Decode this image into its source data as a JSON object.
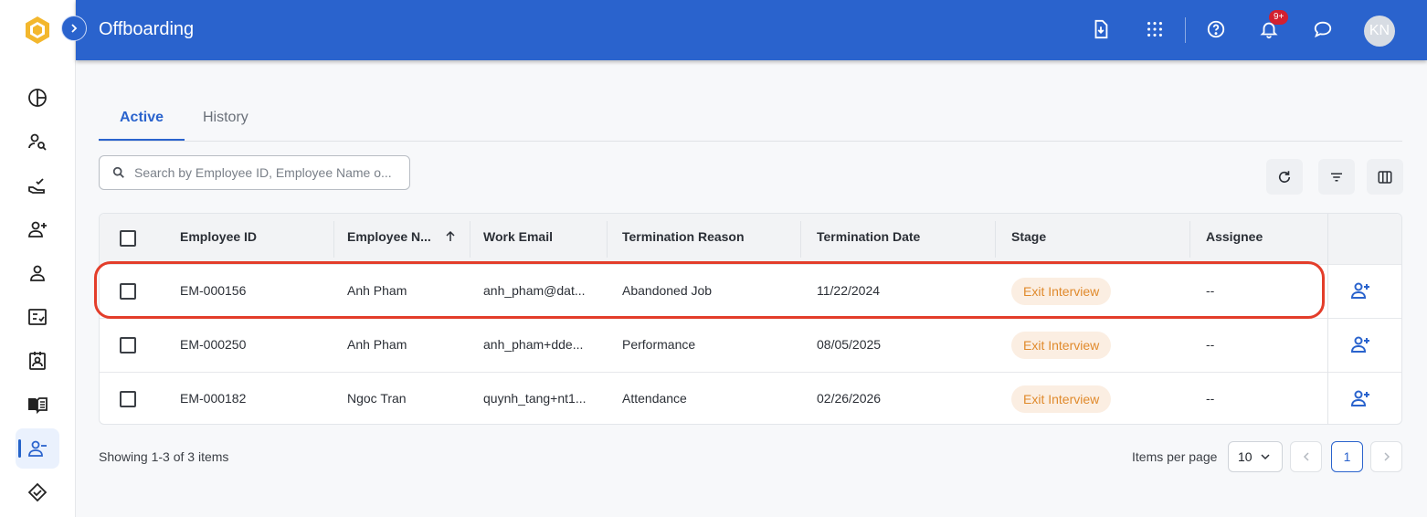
{
  "app": {
    "page_title": "Offboarding",
    "avatar_initials": "KN",
    "notification_badge": "9+"
  },
  "colors": {
    "header": "#2a63cd",
    "accent": "#2a63cd",
    "stage_text": "#e08a2c",
    "stage_bg": "#fbeee2",
    "highlight": "#e33d2a"
  },
  "header_icons": [
    "download-file-icon",
    "apps-grid-icon",
    "help-icon",
    "bell-icon",
    "chat-icon"
  ],
  "sidebar": {
    "items": [
      {
        "icon": "dashboard-pie-icon"
      },
      {
        "icon": "user-search-icon"
      },
      {
        "icon": "hand-check-icon"
      },
      {
        "icon": "user-add-icon"
      },
      {
        "icon": "user-icon"
      },
      {
        "icon": "checklist-icon"
      },
      {
        "icon": "id-badge-icon"
      },
      {
        "icon": "book-open-icon"
      },
      {
        "icon": "user-remove-icon",
        "active": true
      },
      {
        "icon": "handshake-icon"
      }
    ]
  },
  "tabs": [
    {
      "label": "Active",
      "active": true
    },
    {
      "label": "History",
      "active": false
    }
  ],
  "search": {
    "placeholder": "Search by Employee ID, Employee Name o..."
  },
  "table": {
    "columns": [
      "Employee ID",
      "Employee N...",
      "Work Email",
      "Termination Reason",
      "Termination Date",
      "Stage",
      "Assignee"
    ],
    "sorted_column": "Employee N...",
    "sort_direction": "ascending",
    "rows": [
      {
        "employee_id": "EM-000156",
        "name": "Anh Pham",
        "email": "anh_pham@dat...",
        "reason": "Abandoned Job",
        "date": "11/22/2024",
        "stage": "Exit Interview",
        "assignee": "--",
        "highlighted": true
      },
      {
        "employee_id": "EM-000250",
        "name": "Anh Pham",
        "email": "anh_pham+dde...",
        "reason": "Performance",
        "date": "08/05/2025",
        "stage": "Exit Interview",
        "assignee": "--"
      },
      {
        "employee_id": "EM-000182",
        "name": "Ngoc Tran",
        "email": "quynh_tang+nt1...",
        "reason": "Attendance",
        "date": "02/26/2026",
        "stage": "Exit Interview",
        "assignee": "--"
      }
    ]
  },
  "footer": {
    "showing": "Showing 1-3 of 3 items",
    "items_per_page_label": "Items per page",
    "items_per_page": "10",
    "current_page": "1"
  }
}
